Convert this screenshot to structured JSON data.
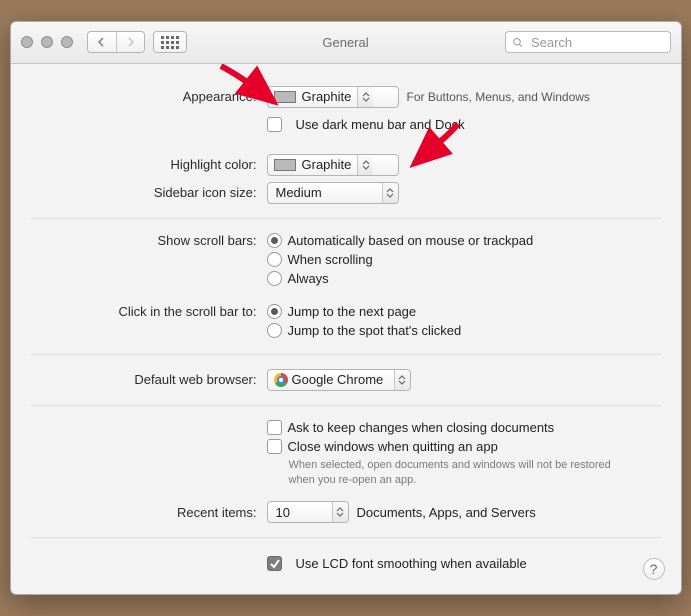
{
  "window": {
    "title": "General"
  },
  "search": {
    "placeholder": "Search"
  },
  "appearance": {
    "label": "Appearance:",
    "value": "Graphite",
    "note": "For Buttons, Menus, and Windows",
    "dark_label": "Use dark menu bar and Dock",
    "dark_checked": false
  },
  "highlight": {
    "label": "Highlight color:",
    "value": "Graphite"
  },
  "sidebar": {
    "label": "Sidebar icon size:",
    "value": "Medium"
  },
  "scrollbars": {
    "label": "Show scroll bars:",
    "options": [
      {
        "text": "Automatically based on mouse or trackpad",
        "selected": true
      },
      {
        "text": "When scrolling",
        "selected": false
      },
      {
        "text": "Always",
        "selected": false
      }
    ]
  },
  "scrollbar_click": {
    "label": "Click in the scroll bar to:",
    "options": [
      {
        "text": "Jump to the next page",
        "selected": true
      },
      {
        "text": "Jump to the spot that's clicked",
        "selected": false
      }
    ]
  },
  "default_browser": {
    "label": "Default web browser:",
    "value": "Google Chrome"
  },
  "documents": {
    "ask_label": "Ask to keep changes when closing documents",
    "ask_checked": false,
    "close_label": "Close windows when quitting an app",
    "close_checked": false,
    "close_hint": "When selected, open documents and windows will not be restored when you re-open an app."
  },
  "recent": {
    "label": "Recent items:",
    "value": "10",
    "note": "Documents, Apps, and Servers"
  },
  "lcd": {
    "label": "Use LCD font smoothing when available",
    "checked": true
  }
}
